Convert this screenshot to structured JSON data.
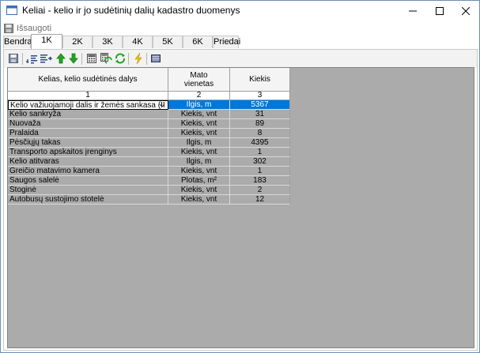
{
  "window": {
    "title": "Keliai - kelio ir jo sudėtinių dalių kadastro duomenys"
  },
  "menu": {
    "save_label": "Išsaugoti"
  },
  "tabs": [
    {
      "label": "Bendra",
      "active": false
    },
    {
      "label": "1K",
      "active": true
    },
    {
      "label": "2K",
      "active": false
    },
    {
      "label": "3K",
      "active": false
    },
    {
      "label": "4K",
      "active": false
    },
    {
      "label": "5K",
      "active": false
    },
    {
      "label": "6K",
      "active": false
    },
    {
      "label": "Priedai",
      "active": false
    }
  ],
  "toolbar": {
    "icons": [
      "save-icon",
      "sort-ascending-icon",
      "sort-descending-icon",
      "move-up-icon",
      "move-down-icon",
      "calculator-icon",
      "calculate-all-icon",
      "refresh-icon",
      "lightning-icon",
      "stack-icon"
    ],
    "up_color": "#1ea81e",
    "refresh_color": "#18a018"
  },
  "grid": {
    "headers": [
      "Kelias, kelio sudėtinės dalys",
      "Mato vienetas",
      "Kiekis"
    ],
    "column_numbers": [
      "1",
      "2",
      "3"
    ],
    "rows": [
      {
        "name": "Kelio važiuojamoji dalis ir žemės sankasa (II  ka",
        "unit": "Ilgis, m",
        "qty": "5367",
        "selected": true
      },
      {
        "name": "Kelio sankryža",
        "unit": "Kiekis, vnt",
        "qty": "31"
      },
      {
        "name": "Nuovaža",
        "unit": "Kiekis, vnt",
        "qty": "89"
      },
      {
        "name": "Pralaida",
        "unit": "Kiekis, vnt",
        "qty": "8"
      },
      {
        "name": "Pėsčiųjų takas",
        "unit": "Ilgis, m",
        "qty": "4395"
      },
      {
        "name": "Transporto apskaitos įrenginys",
        "unit": "Kiekis, vnt",
        "qty": "1"
      },
      {
        "name": "Kelio atitvaras",
        "unit": "Ilgis, m",
        "qty": "302"
      },
      {
        "name": "Greičio matavimo kamera",
        "unit": "Kiekis, vnt",
        "qty": "1"
      },
      {
        "name": "Saugos salelė",
        "unit": "Plotas, m²",
        "qty": "183"
      },
      {
        "name": "Stoginė",
        "unit": "Kiekis, vnt",
        "qty": "2"
      },
      {
        "name": "Autobusų sustojimo stotelė",
        "unit": "Kiekis, vnt",
        "qty": "12"
      }
    ],
    "selection_color": "#0078d7",
    "empty_area_color": "#ababab"
  }
}
